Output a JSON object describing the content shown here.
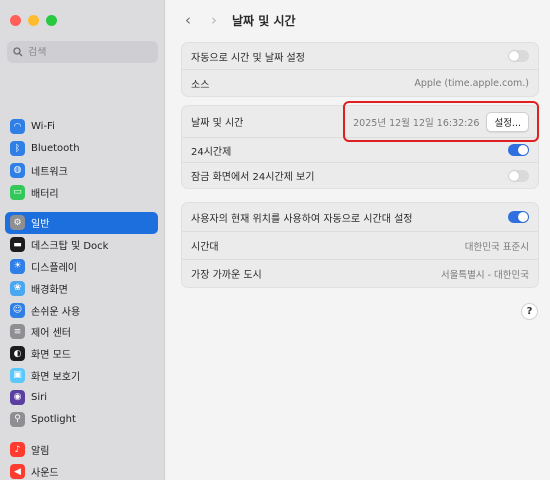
{
  "search": {
    "placeholder": "검색"
  },
  "sidebar": {
    "group1": [
      {
        "label": "Wi-Fi",
        "icon": "wifi-icon",
        "color": "#2f7fe6"
      },
      {
        "label": "Bluetooth",
        "icon": "bluetooth-icon",
        "color": "#2f7fe6"
      },
      {
        "label": "네트워크",
        "icon": "globe-icon",
        "color": "#2f7fe6"
      },
      {
        "label": "배터리",
        "icon": "battery-icon",
        "color": "#34c759"
      }
    ],
    "group2": [
      {
        "label": "일반",
        "icon": "gear-icon",
        "color": "#8e8e93",
        "active": true
      },
      {
        "label": "데스크탑 및 Dock",
        "icon": "dock-icon",
        "color": "#1c1c1e"
      },
      {
        "label": "디스플레이",
        "icon": "sun-icon",
        "color": "#2f7fe6"
      },
      {
        "label": "배경화면",
        "icon": "wallpaper-icon",
        "color": "#4aa8f0"
      },
      {
        "label": "손쉬운 사용",
        "icon": "accessibility-icon",
        "color": "#2f7fe6"
      },
      {
        "label": "제어 센터",
        "icon": "control-center-icon",
        "color": "#8e8e93"
      },
      {
        "label": "화면 모드",
        "icon": "appearance-icon",
        "color": "#1c1c1e"
      },
      {
        "label": "화면 보호기",
        "icon": "screensaver-icon",
        "color": "#5ac8fa"
      },
      {
        "label": "Siri",
        "icon": "siri-icon",
        "color": "#5a3fa0"
      },
      {
        "label": "Spotlight",
        "icon": "magnifier-icon",
        "color": "#8e8e93"
      }
    ],
    "group3": [
      {
        "label": "알림",
        "icon": "bell-icon",
        "color": "#ff3b30"
      },
      {
        "label": "사운드",
        "icon": "speaker-icon",
        "color": "#ff3b30"
      }
    ]
  },
  "header": {
    "title": "날짜 및 시간",
    "back": "‹",
    "forward": "›"
  },
  "group_a": {
    "auto_label": "자동으로 시간 및 날짜 설정",
    "auto_on": false,
    "source_label": "소스",
    "source_value": "Apple (time.apple.com.)"
  },
  "group_b": {
    "datetime_label": "날짜 및 시간",
    "datetime_value": "2025년 12월 12일 16:32:26",
    "set_button": "설정...",
    "h24_label": "24시간제",
    "h24_on": true,
    "lock_label": "잠금 화면에서 24시간제 보기",
    "lock_on": false
  },
  "group_c": {
    "location_label": "사용자의 현재 위치를 사용하여 자동으로 시간대 설정",
    "location_on": true,
    "tz_label": "시간대",
    "tz_value": "대한민국 표준시",
    "city_label": "가장 가까운 도시",
    "city_value": "서울특별시 - 대한민국"
  },
  "help": "?"
}
